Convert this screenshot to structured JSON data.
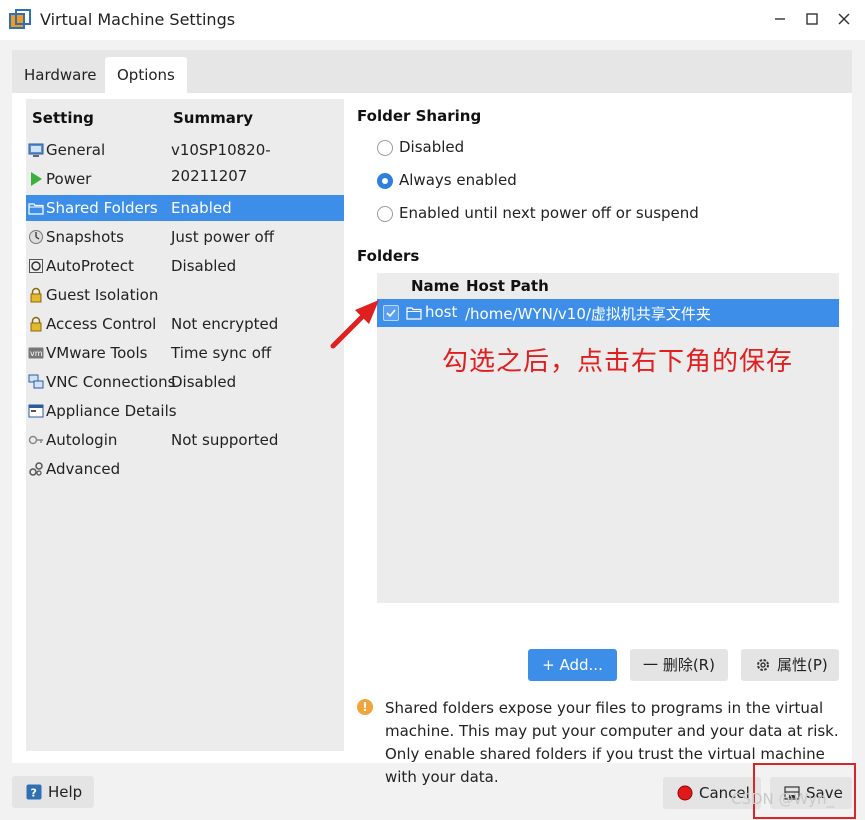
{
  "window": {
    "title": "Virtual Machine Settings",
    "minimize_icon": "minimize-icon",
    "maximize_icon": "maximize-icon",
    "close_icon": "close-icon"
  },
  "tabs": [
    {
      "label": "Hardware",
      "active": false
    },
    {
      "label": "Options",
      "active": true
    }
  ],
  "settings_list": {
    "header_setting": "Setting",
    "header_summary": "Summary",
    "items": [
      {
        "name": "General",
        "summary": "v10SP10820-20211207",
        "icon": "general-icon"
      },
      {
        "name": "Power",
        "summary": "",
        "icon": "power-icon"
      },
      {
        "name": "Shared Folders",
        "summary": "Enabled",
        "icon": "folder-icon",
        "selected": true
      },
      {
        "name": "Snapshots",
        "summary": "Just power off",
        "icon": "snapshot-icon"
      },
      {
        "name": "AutoProtect",
        "summary": "Disabled",
        "icon": "autoprotect-icon"
      },
      {
        "name": "Guest Isolation",
        "summary": "",
        "icon": "lock-icon"
      },
      {
        "name": "Access Control",
        "summary": "Not encrypted",
        "icon": "lock-icon"
      },
      {
        "name": "VMware Tools",
        "summary": "Time sync off",
        "icon": "vm-icon"
      },
      {
        "name": "VNC Connections",
        "summary": "Disabled",
        "icon": "vnc-icon"
      },
      {
        "name": "Appliance Details",
        "summary": "",
        "icon": "appliance-icon"
      },
      {
        "name": "Autologin",
        "summary": "Not supported",
        "icon": "key-icon"
      },
      {
        "name": "Advanced",
        "summary": "",
        "icon": "advanced-icon"
      }
    ]
  },
  "folder_sharing": {
    "title": "Folder Sharing",
    "options": [
      {
        "label": "Disabled",
        "checked": false
      },
      {
        "label": "Always enabled",
        "checked": true
      },
      {
        "label": "Enabled until next power off or suspend",
        "checked": false
      }
    ]
  },
  "folders": {
    "title": "Folders",
    "col_name": "Name",
    "col_path": "Host Path",
    "rows": [
      {
        "checked": true,
        "name": "host",
        "path": "/home/WYN/v10/虚拟机共享文件夹"
      }
    ]
  },
  "annotation": {
    "text": "勾选之后，点击右下角的保存",
    "color": "#e02020"
  },
  "folder_buttons": {
    "add": "+ Add...",
    "delete": "一 删除(R)",
    "properties": "属性(P)"
  },
  "warning": {
    "text": "Shared folders expose your files to programs in the virtual machine. This may put your computer and your data at risk. Only enable shared folders if you trust the virtual machine with your data."
  },
  "footer": {
    "help": "Help",
    "cancel": "Cancel",
    "save": "Save",
    "watermark": "CSDN @Wyn_"
  },
  "colors": {
    "accent": "#3d8ee8",
    "annotation_red": "#e02020",
    "warning_orange": "#f2a43a"
  }
}
